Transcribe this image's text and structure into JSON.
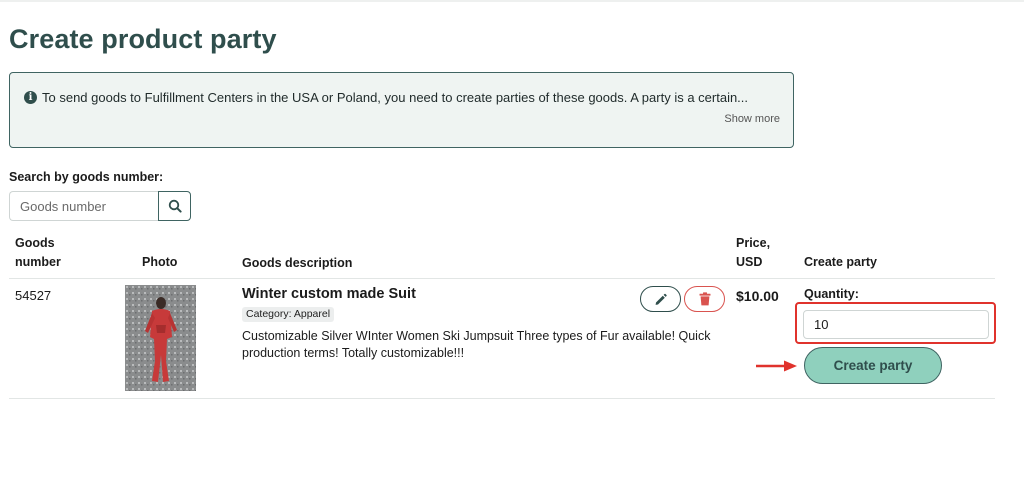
{
  "page": {
    "title": "Create product party"
  },
  "info": {
    "text": "To send goods to Fulfillment Centers in the USA or Poland, you need to create parties of these goods. A party is a certain...",
    "show_more": "Show more"
  },
  "search": {
    "label": "Search by goods number:",
    "placeholder": "Goods number"
  },
  "table": {
    "headers": {
      "goods_number_line1": "Goods",
      "goods_number_line2": "number",
      "photo": "Photo",
      "description": "Goods description",
      "price_line1": "Price,",
      "price_line2": "USD",
      "create_party": "Create party"
    },
    "rows": [
      {
        "goods_number": "54527",
        "title": "Winter custom made Suit",
        "category": "Category: Apparel",
        "description": "Customizable Silver WInter Women Ski Jumpsuit Three types of Fur available! Quick production terms! Totally customizable!!!",
        "price": "$10.00",
        "quantity_label": "Quantity:",
        "quantity_value": "10",
        "create_button": "Create party"
      }
    ]
  },
  "colors": {
    "title": "#2f4e4c",
    "accent_button": "#8fd0bd",
    "highlight": "#e0322c",
    "danger": "#d9534f"
  },
  "icons": {
    "info": "info-icon",
    "search": "search-icon",
    "edit": "pencil-icon",
    "delete": "trash-icon",
    "arrow": "arrow-right-icon"
  }
}
